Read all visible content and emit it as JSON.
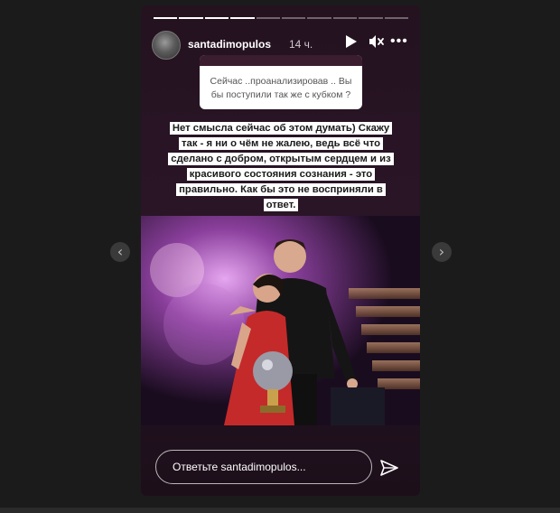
{
  "story": {
    "username": "santadimopulos",
    "time_ago": "14 ч.",
    "progress": {
      "total_segments": 10,
      "current_segment": 4
    },
    "question": {
      "text": "Сейчас ..проанализировав .. Вы бы поступили так же с кубком ?"
    },
    "answer": {
      "text": "Нет смысла сейчас об этом думать) Скажу так - я ни о чём не жалею, ведь всё что сделано с добром, открытым сердцем и из красивого состояния сознания - это правильно. Как бы это не восприняли в ответ."
    },
    "reply_placeholder": "Ответьте santadimopulos..."
  },
  "controls": {
    "play_icon": "play-icon",
    "mute_icon": "mute-icon",
    "more_icon": "more-icon",
    "send_icon": "send-icon",
    "prev_icon": "chevron-left-icon",
    "next_icon": "chevron-right-icon"
  },
  "colors": {
    "viewer_bg": "#1b1b1b",
    "story_bg": "#24121f",
    "highlight": "#ffffff"
  }
}
